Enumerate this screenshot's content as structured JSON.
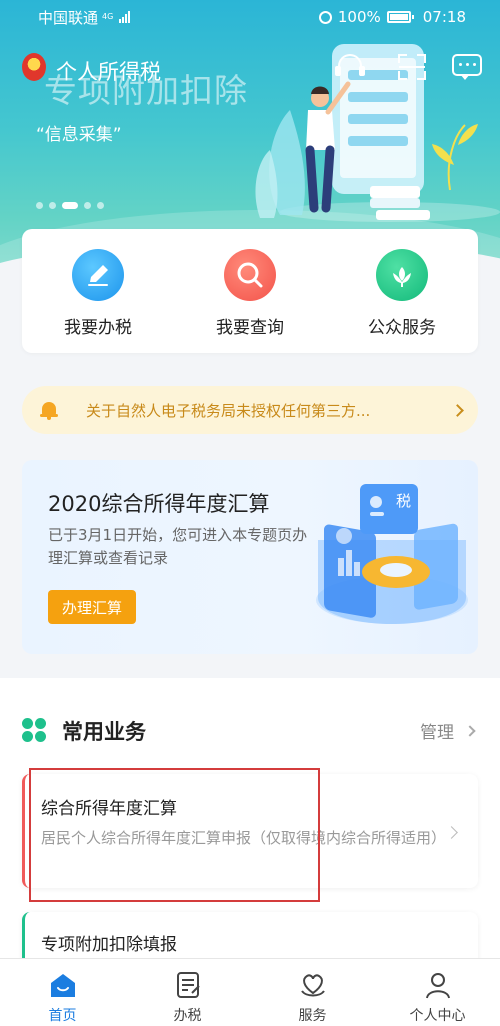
{
  "status": {
    "carrier": "中国联通",
    "network": "4G",
    "battery": "100%",
    "time": "07:18"
  },
  "app": {
    "title": "个人所得税"
  },
  "banner": {
    "title": "专项附加扣除",
    "subtitle": "“信息采集”",
    "active_slide": 3,
    "slide_count": 5
  },
  "quick_actions": [
    {
      "label": "我要办税",
      "icon": "pen-icon"
    },
    {
      "label": "我要查询",
      "icon": "search-icon"
    },
    {
      "label": "公众服务",
      "icon": "flower-icon"
    }
  ],
  "notice": {
    "text": "关于自然人电子税务局未授权任何第三方..."
  },
  "annual": {
    "title": "2020综合所得年度汇算",
    "desc": "已于3月1日开始，您可进入本专题页办理汇算或查看记录",
    "button": "办理汇算",
    "badge": "税"
  },
  "services": {
    "title": "常用业务",
    "manage": "管理",
    "items": [
      {
        "title": "综合所得年度汇算",
        "desc": "居民个人综合所得年度汇算申报（仅取得境内综合所得适用）"
      },
      {
        "title": "专项附加扣除填报"
      }
    ]
  },
  "bottom_nav": [
    {
      "label": "首页",
      "icon": "home-icon",
      "active": true
    },
    {
      "label": "办税",
      "icon": "form-icon"
    },
    {
      "label": "服务",
      "icon": "heart-hand-icon"
    },
    {
      "label": "个人中心",
      "icon": "person-icon"
    }
  ],
  "colors": {
    "accent": "#1b7de0",
    "warning": "#f5a10f",
    "highlight": "#d43c3c"
  }
}
